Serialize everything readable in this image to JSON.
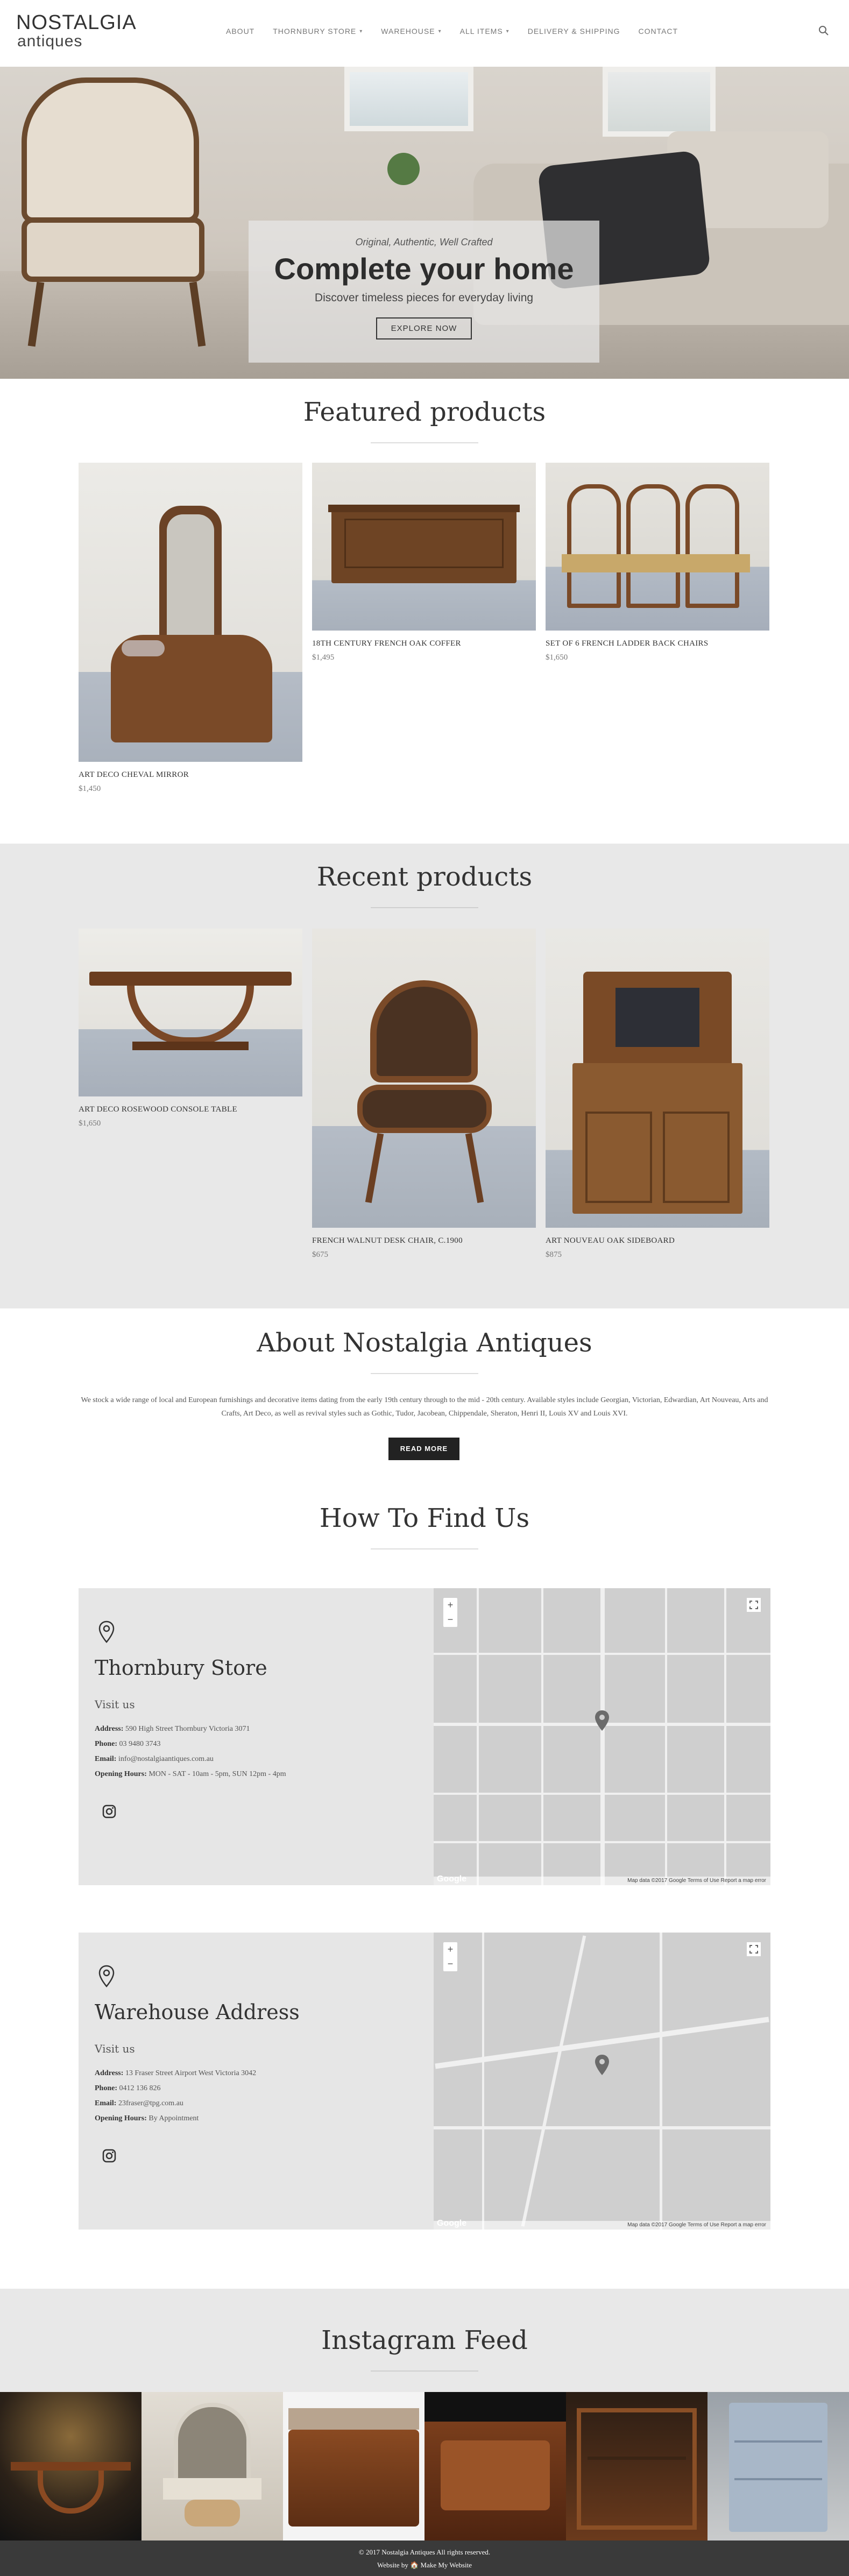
{
  "header": {
    "logo_line1": "NOSTALGIA",
    "logo_line2": "antiques",
    "nav": [
      {
        "label": "ABOUT",
        "dropdown": false
      },
      {
        "label": "THORNBURY STORE",
        "dropdown": true
      },
      {
        "label": "WAREHOUSE",
        "dropdown": true
      },
      {
        "label": "ALL ITEMS",
        "dropdown": true
      },
      {
        "label": "DELIVERY & SHIPPING",
        "dropdown": false
      },
      {
        "label": "CONTACT",
        "dropdown": false
      }
    ],
    "search_icon": "search-icon"
  },
  "hero": {
    "kicker": "Original, Authentic, Well Crafted",
    "title": "Complete your home",
    "subtitle": "Discover timeless pieces for everyday living",
    "button": "EXPLORE NOW"
  },
  "featured": {
    "title": "Featured products",
    "items": [
      {
        "name": "ART DECO CHEVAL MIRROR",
        "price": "$1,450"
      },
      {
        "name": "18TH CENTURY FRENCH OAK COFFER",
        "price": "$1,495"
      },
      {
        "name": "SET OF 6 FRENCH LADDER BACK CHAIRS",
        "price": "$1,650"
      }
    ]
  },
  "recent": {
    "title": "Recent products",
    "items": [
      {
        "name": "ART DECO ROSEWOOD CONSOLE TABLE",
        "price": "$1,650"
      },
      {
        "name": "FRENCH WALNUT DESK CHAIR, C.1900",
        "price": "$675"
      },
      {
        "name": "ART NOUVEAU OAK SIDEBOARD",
        "price": "$875"
      }
    ]
  },
  "about": {
    "title": "About Nostalgia Antiques",
    "text": "We stock a wide range of local and European furnishings and decorative items dating from the early 19th century through to the mid - 20th century. Available styles include Georgian, Victorian, Edwardian, Art Nouveau, Arts and Crafts, Art Deco, as well as revival styles such as Gothic, Tudor, Jacobean, Chippendale, Sheraton, Henri II, Louis XV and Louis XVI.",
    "button": "READ MORE"
  },
  "find_us": {
    "title": "How To Find Us",
    "locations": [
      {
        "title": "Thornbury Store",
        "visit": "Visit us",
        "address_label": "Address:",
        "address": "590 High Street Thornbury Victoria 3071",
        "phone_label": "Phone:",
        "phone": "03 9480 3743",
        "email_label": "Email:",
        "email": "info@nostalgiaantiques.com.au",
        "hours_label": "Opening Hours:",
        "hours": "MON - SAT - 10am - 5pm, SUN 12pm - 4pm",
        "map_attribution": "Map data ©2017 Google   Terms of Use   Report a map error"
      },
      {
        "title": "Warehouse Address",
        "visit": "Visit us",
        "address_label": "Address:",
        "address": "13 Fraser Street Airport West Victoria 3042",
        "phone_label": "Phone:",
        "phone": "0412 136 826",
        "email_label": "Email:",
        "email": "23fraser@tpg.com.au",
        "hours_label": "Opening Hours:",
        "hours": "By Appointment",
        "map_attribution": "Map data ©2017 Google   Terms of Use   Report a map error"
      }
    ]
  },
  "instagram": {
    "title": "Instagram Feed"
  },
  "footer": {
    "copyright": "© 2017 Nostalgia Antiques All rights reserved.",
    "credit": "Website by 🏠 Make My Website"
  }
}
